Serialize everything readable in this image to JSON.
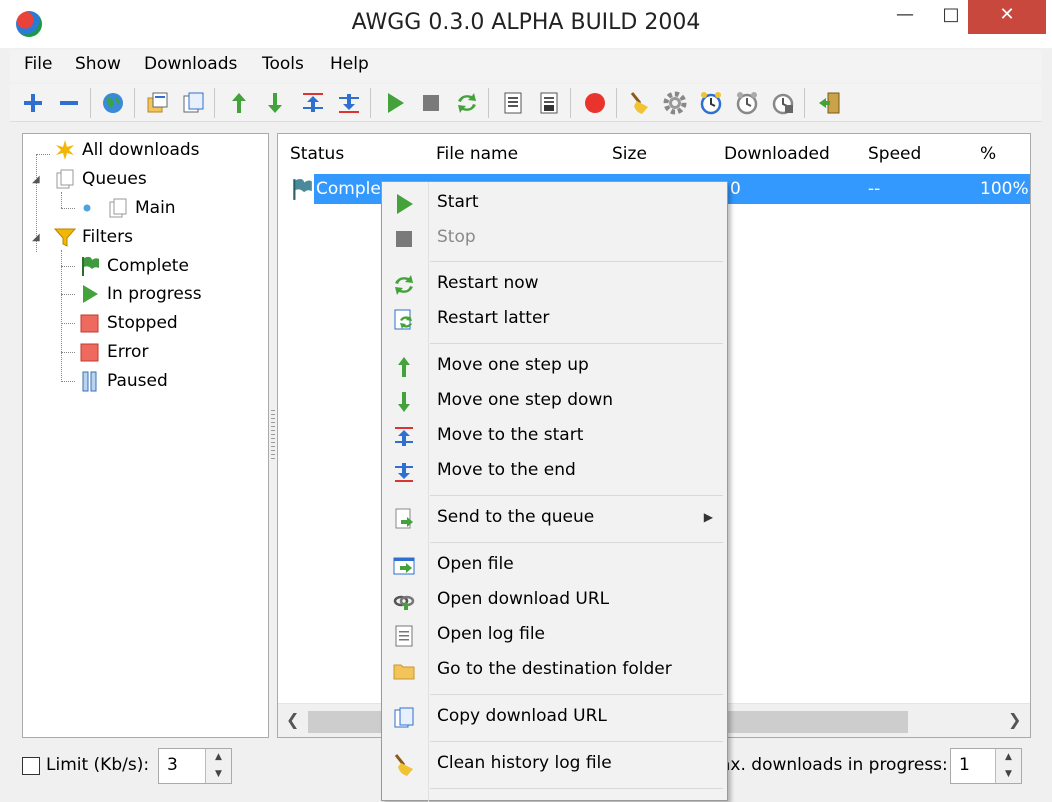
{
  "window": {
    "title": "AWGG 0.3.0 ALPHA BUILD 2004",
    "minimize": "—",
    "maximize": "□",
    "close": "✕"
  },
  "menu": [
    "File",
    "Show",
    "Downloads",
    "Tools",
    "Help"
  ],
  "toolbar_icons": [
    "add-icon",
    "remove-icon",
    "globe-icon",
    "new-queue-icon",
    "copy-icon",
    "up-arrow-icon",
    "down-arrow-icon",
    "move-top-icon",
    "move-bottom-icon",
    "play-icon",
    "stop-icon",
    "restart-icon",
    "log-icon",
    "log2-icon",
    "record-icon",
    "broom-icon",
    "gear-icon",
    "clock-icon",
    "scheduler-icon",
    "scheduler2-icon",
    "exit-icon"
  ],
  "tree": {
    "all": "All downloads",
    "queues": "Queues",
    "main": "Main",
    "filters": "Filters",
    "complete": "Complete",
    "in_progress": "In progress",
    "stopped": "Stopped",
    "error": "Error",
    "paused": "Paused"
  },
  "list": {
    "columns": [
      "Status",
      "File name",
      "Size",
      "Downloaded",
      "Speed",
      "%"
    ],
    "row": {
      "status": "Comple",
      "downloaded": "0",
      "speed": "--",
      "percent": "100%"
    }
  },
  "context_menu": {
    "start": "Start",
    "stop": "Stop",
    "restart_now": "Restart now",
    "restart_later": "Restart latter",
    "move_up": "Move one step up",
    "move_down": "Move one step down",
    "move_start": "Move to the start",
    "move_end": "Move to the end",
    "send_queue": "Send to the queue",
    "open_file": "Open file",
    "open_url": "Open download URL",
    "open_log": "Open log file",
    "goto_folder": "Go to the destination folder",
    "copy_url": "Copy download URL",
    "clean_log": "Clean history log file"
  },
  "status": {
    "limit_label": "Limit (Kb/s):",
    "limit_value": "3",
    "max_label": "ax. downloads in progress:",
    "max_value": "1"
  },
  "colors": {
    "selection": "#3399ff",
    "close_button": "#c9483e"
  }
}
